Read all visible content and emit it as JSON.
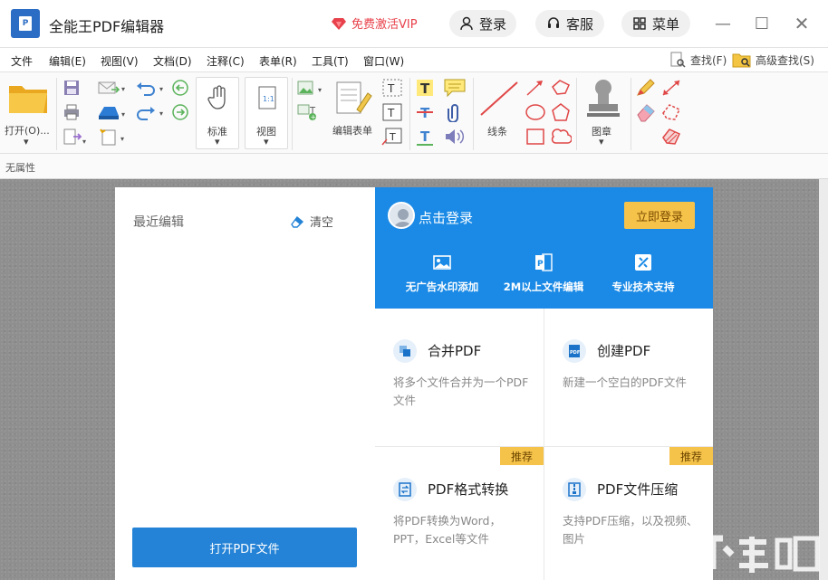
{
  "titlebar": {
    "logo_text": "P",
    "title": "全能王PDF编辑器",
    "vip": "免费激活VIP",
    "login": "登录",
    "service": "客服",
    "menu": "菜单",
    "minimize": "—",
    "maximize": "☐",
    "close": "✕"
  },
  "menubar": {
    "items": [
      "文件",
      "编辑(E)",
      "视图(V)",
      "文档(D)",
      "注释(C)",
      "表单(R)",
      "工具(T)",
      "窗口(W)"
    ],
    "find": "查找(F)",
    "advanced_find": "高级查找(S)"
  },
  "ribbon": {
    "open": "打开(O)...",
    "standard": "标准",
    "view": "视图",
    "edit_form": "编辑表单",
    "lines": "线条",
    "stamp": "图章"
  },
  "propbar": {
    "text": "无属性"
  },
  "left_panel": {
    "recent": "最近编辑",
    "clear": "清空",
    "open_pdf": "打开PDF文件"
  },
  "login_box": {
    "click_login": "点击登录",
    "login_now": "立即登录",
    "features": [
      "无广告水印添加",
      "2M以上文件编辑",
      "专业技术支持"
    ]
  },
  "tiles": [
    {
      "title": "合并PDF",
      "desc": "将多个文件合并为一个PDF文件",
      "tag": ""
    },
    {
      "title": "创建PDF",
      "desc": "新建一个空白的PDF文件",
      "tag": ""
    },
    {
      "title": "PDF格式转换",
      "desc": "将PDF转换为Word，PPT，Excel等文件",
      "tag": "推荐"
    },
    {
      "title": "PDF文件压缩",
      "desc": "支持PDF压缩，以及视频、图片",
      "tag": "推荐"
    }
  ],
  "colors": {
    "accent": "#2483d6",
    "login_bg": "#1a8ae6",
    "tag": "#f6c34a",
    "vip": "#e8414b"
  }
}
